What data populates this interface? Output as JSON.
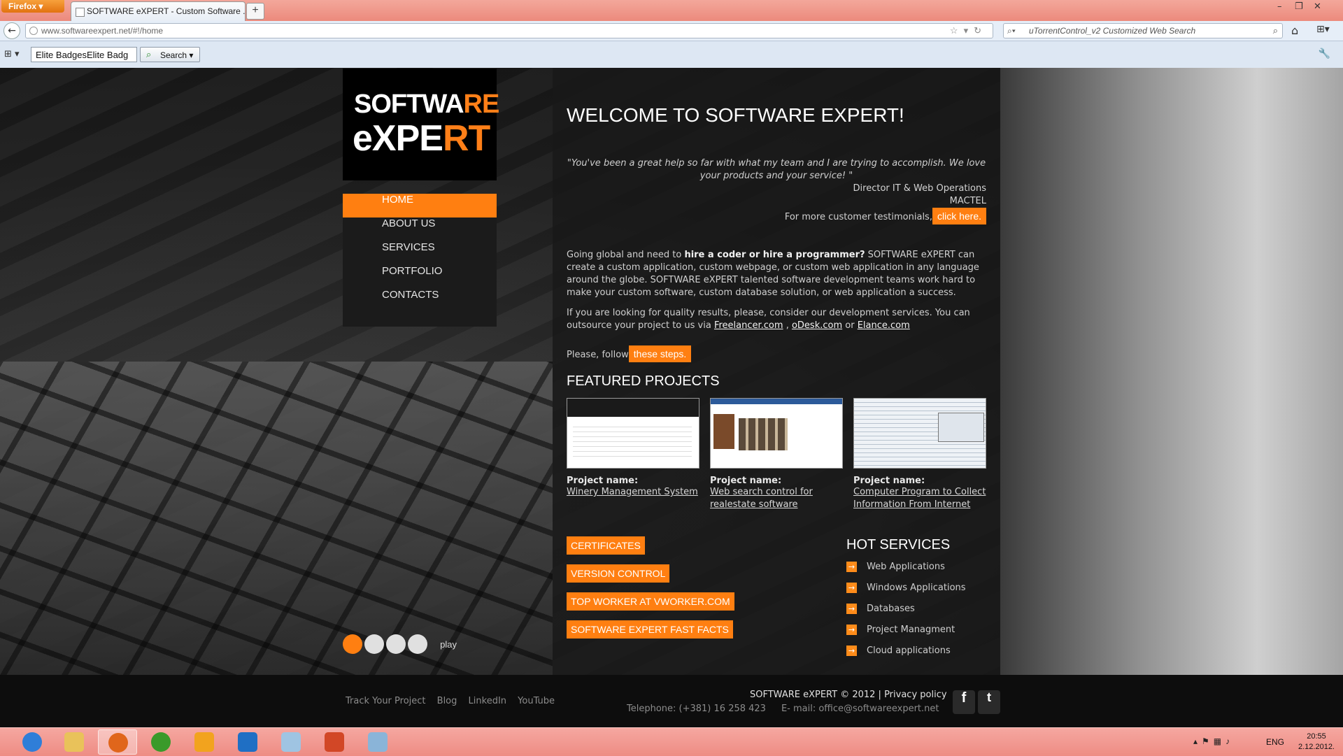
{
  "browser": {
    "firefox_label": "Firefox",
    "tab_title": "SOFTWARE eXPERT - Custom Software ...",
    "new_tab": "+",
    "url": "www.softwareexpert.net/#!/home",
    "search_placeholder": "uTorrentControl_v2 Customized Web Search",
    "toolbar_select": "Elite BadgesElite Badg",
    "toolbar_search": "Search"
  },
  "logo": {
    "line1a": "SOFTWA",
    "line1b": "RE",
    "line2a": "eXPE",
    "line2b": "RT"
  },
  "nav": [
    "HOME",
    "ABOUT US",
    "SERVICES",
    "PORTFOLIO",
    "CONTACTS"
  ],
  "slider": {
    "play": "play"
  },
  "content": {
    "title": "WELCOME TO SOFTWARE EXPERT!",
    "quote": "\"You've been a great help so far with what my team and I are trying to accomplish. We love your products and your service! \"",
    "quote_role": "Director IT & Web Operations",
    "quote_company": "MACTEL",
    "more_testimonials": "For more customer testimonials,",
    "click_here": "click here.",
    "p1_a": "Going global and need to ",
    "p1_b": "hire a coder or hire a programmer?",
    "p1_c": " SOFTWARE eXPERT can create a custom application, custom webpage, or custom web application in any language around the globe. SOFTWARE eXPERT talented software development teams work hard to make your custom software, custom database solution, or web application a success.",
    "p2_a": "If you are looking for quality results, please, consider our development services. You can outsource your project to us via ",
    "link_freelancer": "Freelancer.com",
    "sep1": " , ",
    "link_odesk": "oDesk.com",
    "sep2": " or ",
    "link_elance": "Elance.com",
    "please_follow": "Please, follow",
    "these_steps": "these steps.",
    "featured_title": "FEATURED PROJECTS",
    "projects": [
      {
        "label": "Project name:",
        "name_l1": "Winery Management System",
        "name_l2": ""
      },
      {
        "label": "Project name:",
        "name_l1": "Web search control for",
        "name_l2": "realestate software"
      },
      {
        "label": "Project name:",
        "name_l1": "Computer Program to Collect",
        "name_l2": "Information From Internet"
      }
    ],
    "tags": [
      "CERTIFICATES",
      "VERSION CONTROL",
      "TOP WORKER AT VWORKER.COM",
      "SOFTWARE EXPERT FAST FACTS"
    ],
    "hot_title": "HOT SERVICES",
    "hot_items": [
      "Web Applications",
      "Windows Applications",
      "Databases",
      "Project Managment",
      "Cloud applications"
    ]
  },
  "footer": {
    "links": [
      "Track Your Project",
      "Blog",
      "LinkedIn",
      "YouTube"
    ],
    "copyright": "SOFTWARE eXPERT © 2012 | Privacy policy",
    "phone": "Telephone: (+381) 16 258 423",
    "email": "E- mail: office@softwareexpert.net"
  },
  "taskbar": {
    "lang": "ENG",
    "time": "20:55",
    "date": "2.12.2012."
  },
  "colors": {
    "accent": "#ff7f11",
    "content_bg": "#181818",
    "footer_bg": "#0d0d0d"
  }
}
